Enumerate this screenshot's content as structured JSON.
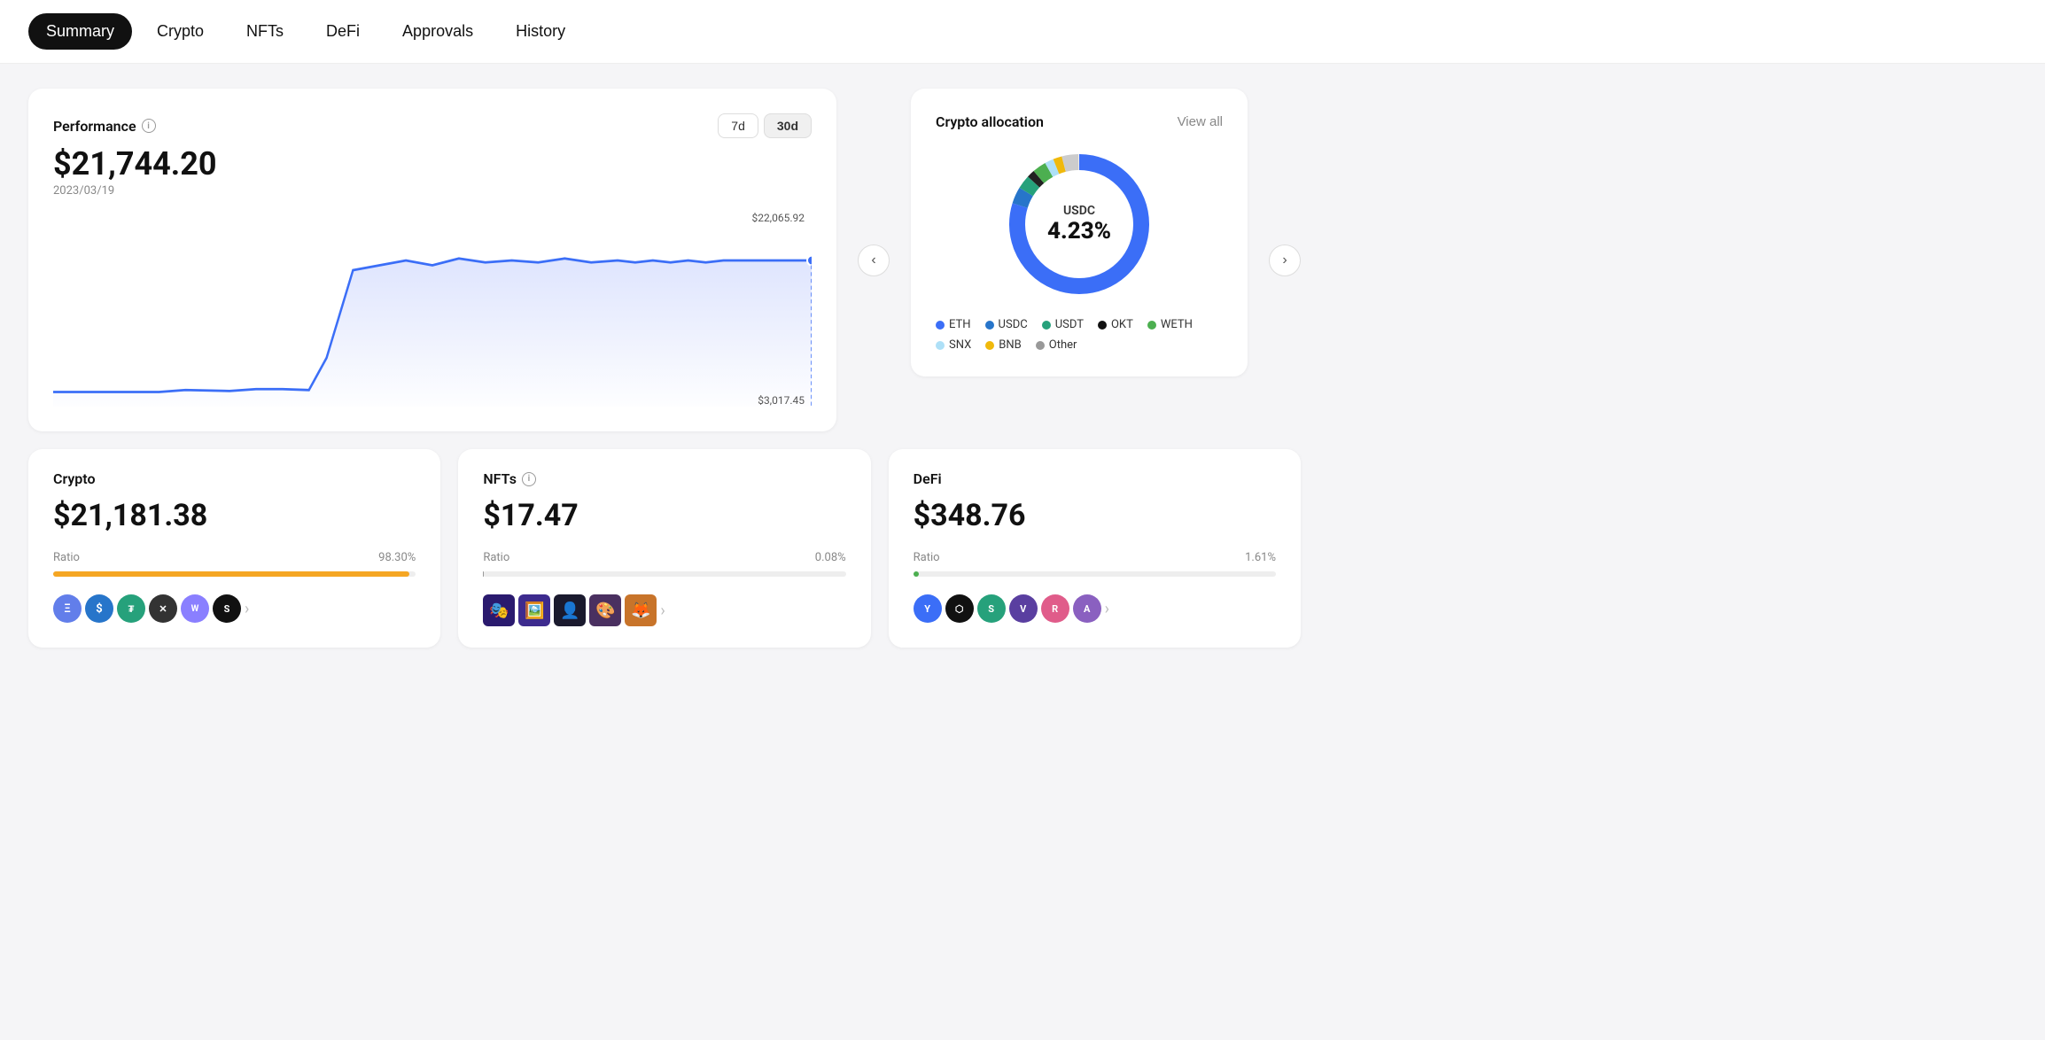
{
  "nav": {
    "tabs": [
      {
        "label": "Summary",
        "active": true
      },
      {
        "label": "Crypto",
        "active": false
      },
      {
        "label": "NFTs",
        "active": false
      },
      {
        "label": "DeFi",
        "active": false
      },
      {
        "label": "Approvals",
        "active": false
      },
      {
        "label": "History",
        "active": false
      }
    ]
  },
  "performance": {
    "title": "Performance",
    "amount": "$21,744.20",
    "date": "2023/03/19",
    "label_top": "$22,065.92",
    "label_bottom": "$3,017.45",
    "time_buttons": [
      "7d",
      "30d"
    ],
    "active_time": "30d"
  },
  "crypto_allocation": {
    "title": "Crypto allocation",
    "view_all": "View all",
    "center_label": "USDC",
    "center_pct": "4.23%",
    "legend": [
      {
        "label": "ETH",
        "color": "#3b6ef7"
      },
      {
        "label": "USDC",
        "color": "#2775ca"
      },
      {
        "label": "USDT",
        "color": "#26a17b"
      },
      {
        "label": "OKT",
        "color": "#111"
      },
      {
        "label": "WETH",
        "color": "#4caf50"
      },
      {
        "label": "SNX",
        "color": "#aee0f7"
      },
      {
        "label": "BNB",
        "color": "#f0b90b"
      },
      {
        "label": "Other",
        "color": "#999"
      }
    ]
  },
  "cards": {
    "crypto": {
      "title": "Crypto",
      "amount": "$21,181.38",
      "ratio_label": "Ratio",
      "ratio_pct": "98.30%",
      "bar_color": "#f5a623",
      "bar_width": "98.3"
    },
    "nfts": {
      "title": "NFTs",
      "amount": "$17.47",
      "ratio_label": "Ratio",
      "ratio_pct": "0.08%",
      "bar_color": "#999",
      "bar_width": "0.08"
    },
    "defi": {
      "title": "DeFi",
      "amount": "$348.76",
      "ratio_label": "Ratio",
      "ratio_pct": "1.61%",
      "bar_color": "#4caf50",
      "bar_width": "1.61"
    }
  }
}
